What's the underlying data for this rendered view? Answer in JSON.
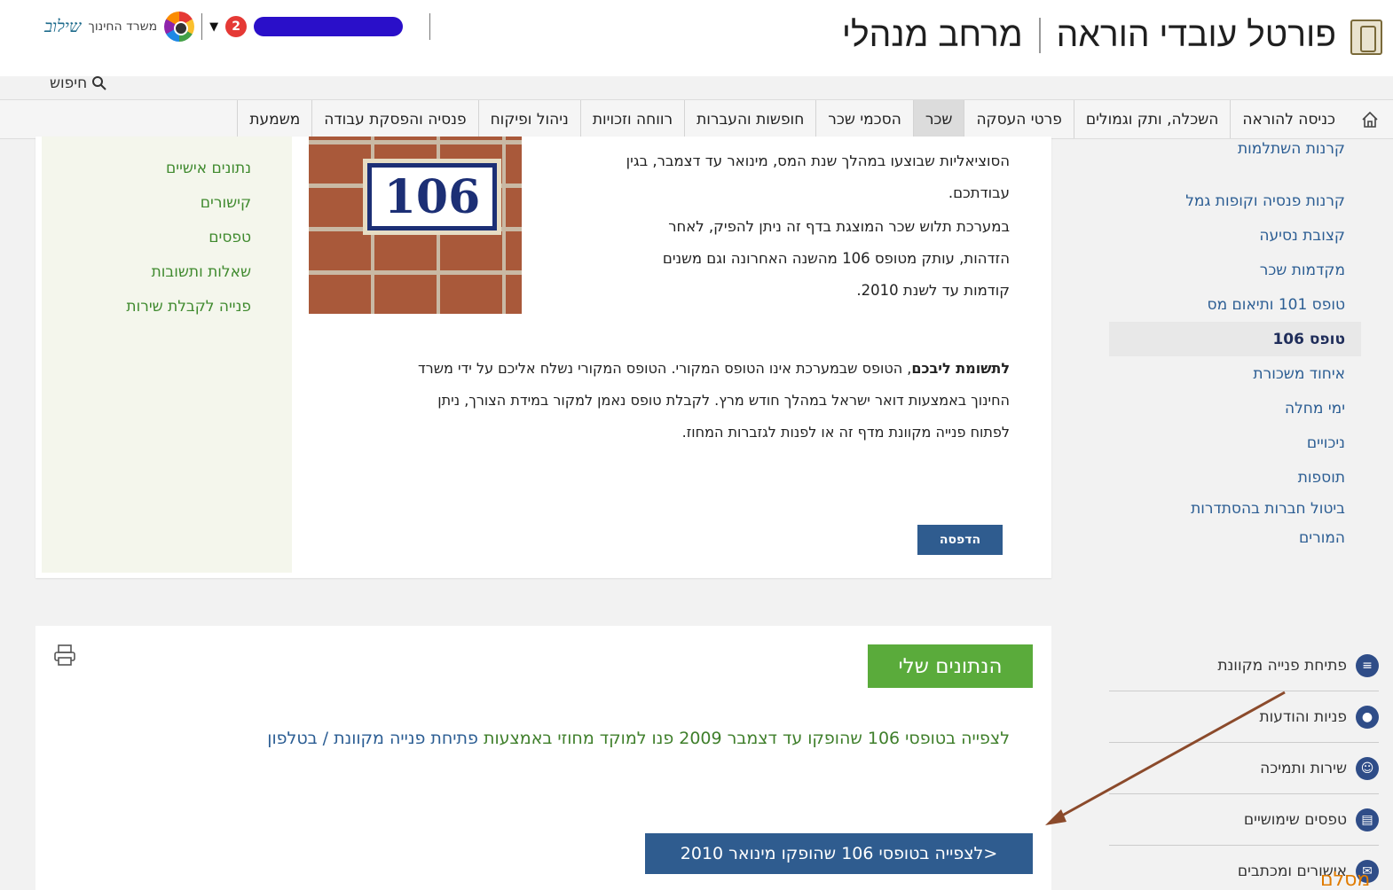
{
  "header": {
    "portal_title": "פורטל עובדי הוראה",
    "space_title": "מרחב מנהלי",
    "ministry_name": "משרד החינוך",
    "ministry_brand": "שילוב",
    "notifications_count": "2",
    "search_label": "חיפוש"
  },
  "nav": {
    "items": [
      "כניסה להוראה",
      "השכלה, ותק וגמולים",
      "פרטי העסקה",
      "שכר",
      "הסכמי שכר",
      "חופשות והעברות",
      "רווחה וזכויות",
      "ניהול ופיקוח",
      "פנסיה והפסקת עבודה",
      "משמעת"
    ],
    "active": "שכר"
  },
  "sidebar": {
    "items": [
      "קרנות השתלמות",
      "קרנות פנסיה וקופות גמל",
      "קצובת נסיעה",
      "מקדמות שכר",
      "טופס 101 ותיאום מס",
      "טופס 106",
      "איחוד משכורת",
      "ימי מחלה",
      "ניכויים",
      "תוספות",
      "ביטול חברות בהסתדרות המורים"
    ],
    "active": "טופס 106"
  },
  "side_links": [
    {
      "label": "פתיחת פנייה מקוונת",
      "icon": "chat-icon"
    },
    {
      "label": "פניות והודעות",
      "icon": "user-icon"
    },
    {
      "label": "שירות ותמיכה",
      "icon": "support-icon"
    },
    {
      "label": "טפסים שימושיים",
      "icon": "document-icon"
    },
    {
      "label": "אישורים ומכתבים",
      "icon": "certificate-icon"
    }
  ],
  "left_links": [
    "נתונים אישיים",
    "קישורים",
    "טפסים",
    "שאלות ותשובות",
    "פנייה לקבלת שירות"
  ],
  "image": {
    "plate_number": "106"
  },
  "content": {
    "para1_line1": "הסוציאליות שבוצעו במהלך שנת המס, מינואר עד דצמבר, בגין",
    "para1_line2": "עבודתכם.",
    "para2_line1": "במערכת תלוש שכר המוצגת בדף זה ניתן להפיק, לאחר",
    "para2_line2": "הזדהות, עותק מטופס 106 מהשנה האחרונה וגם משנים",
    "para2_line3": "קודמות עד לשנת 2010.",
    "note_bold": "לתשומת ליבכם",
    "note_line1": ", הטופס שבמערכת אינו הטופס המקורי. הטופס המקורי נשלח אליכם על ידי משרד",
    "note_line2": "החינוך באמצעות דואר ישראל במהלך חודש מרץ. לקבלת טופס נאמן למקור במידת הצורך, ניתן",
    "note_line3": "לפתוח פנייה מקוונת מדף זה או לפנות לגזברות המחוז.",
    "print_button": "הדפסה"
  },
  "my_data": {
    "title": "הנתונים שלי",
    "lead_text": "לצפייה בטופסי 106 שהופקו עד דצמבר 2009 פנו למוקד מחוזי באמצעות",
    "lead_link1": "פתיחת פנייה מקוונת",
    "lead_sep": " / ",
    "lead_link2": "בטלפון",
    "view_button": "לצפייה בטופסי 106 שהופקו מינואר 2010>"
  },
  "overflow_text": "מסלם",
  "colors": {
    "accent_green": "#5aab3b",
    "button_blue": "#2f5c8f",
    "link_blue": "#2b5d93",
    "user_pill": "#2a0fc9",
    "badge_red": "#e53935",
    "arrow": "#8b4a2b"
  }
}
